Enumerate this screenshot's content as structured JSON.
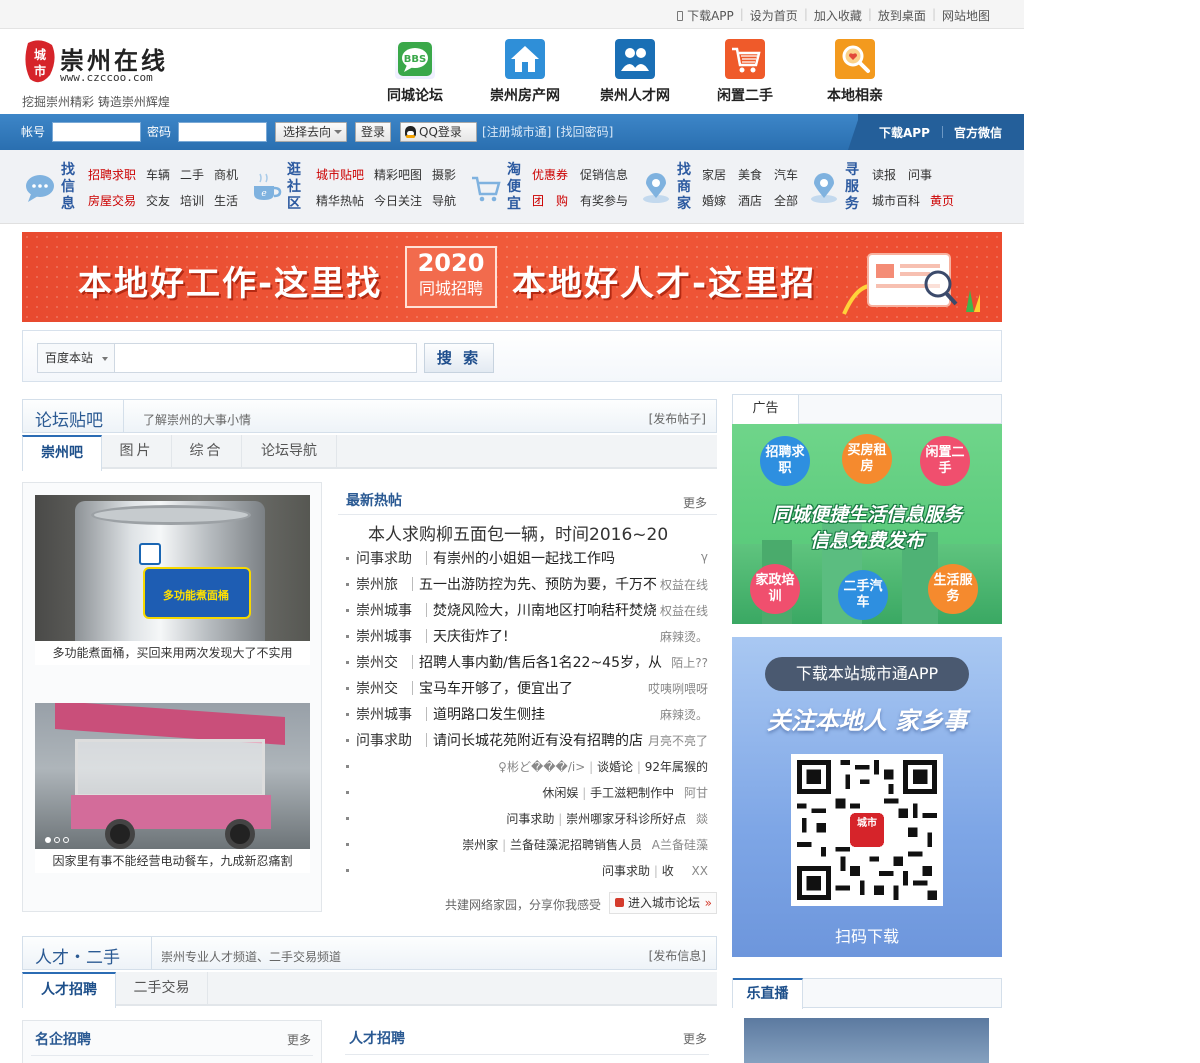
{
  "topbar": {
    "links": [
      "下载APP",
      "设为首页",
      "加入收藏",
      "放到桌面",
      "网站地图"
    ]
  },
  "header": {
    "logo_title": "崇州在线",
    "logo_url": "www.czccoo.com",
    "logo_mark_text": "城市",
    "slogan": "挖掘崇州精彩 铸造崇州辉煌",
    "nav": [
      {
        "label": "同城论坛",
        "icon": "bbs-icon",
        "color": "#3aa84a"
      },
      {
        "label": "崇州房产网",
        "icon": "house-icon",
        "color": "#2f8fd8"
      },
      {
        "label": "崇州人才网",
        "icon": "people-icon",
        "color": "#1a6fb5"
      },
      {
        "label": "闲置二手",
        "icon": "cart-icon",
        "color": "#ef5a2a"
      },
      {
        "label": "本地相亲",
        "icon": "search-heart-icon",
        "color": "#f39a1e"
      }
    ]
  },
  "login": {
    "account_label": "帐号",
    "password_label": "密码",
    "goto_select": "选择去向",
    "login_button": "登录",
    "qq_login": "QQ登录",
    "register": "[注册城市通]",
    "recover": "[找回密码]",
    "download_app": "下载APP",
    "official_wechat": "官方微信"
  },
  "categories": [
    {
      "title": "找信息",
      "icon": "chat-bubble-icon",
      "links": [
        {
          "t": "招聘求职",
          "red": true
        },
        {
          "t": "车辆"
        },
        {
          "t": "二手"
        },
        {
          "t": "商机"
        },
        {
          "t": "房屋交易",
          "red": true
        },
        {
          "t": "交友"
        },
        {
          "t": "培训"
        },
        {
          "t": "生活"
        }
      ]
    },
    {
      "title": "逛社区",
      "icon": "coffee-cup-icon",
      "links": [
        {
          "t": "城市贴吧",
          "red": true
        },
        {
          "t": "精彩吧图"
        },
        {
          "t": "摄影"
        },
        {
          "t": "精华热帖"
        },
        {
          "t": "今日关注"
        },
        {
          "t": "导航"
        }
      ]
    },
    {
      "title": "淘便宜",
      "icon": "shopping-cart-icon",
      "links": [
        {
          "t": "优惠券",
          "red": true
        },
        {
          "t": "促销信息"
        },
        {
          "t": "团　购",
          "red": true
        },
        {
          "t": "有奖参与"
        }
      ]
    },
    {
      "title": "找商家",
      "icon": "map-pin-icon",
      "links": [
        {
          "t": "家居"
        },
        {
          "t": "美食"
        },
        {
          "t": "汽车"
        },
        {
          "t": "婚嫁"
        },
        {
          "t": "酒店"
        },
        {
          "t": "全部"
        }
      ]
    },
    {
      "title": "寻服务",
      "icon": "service-pin-icon",
      "links": [
        {
          "t": "读报"
        },
        {
          "t": "问事"
        },
        {
          "t": "城市百科"
        },
        {
          "t": "黄页",
          "red": true
        }
      ]
    }
  ],
  "banner": {
    "left": "本地好工作-这里找",
    "year": "2020",
    "badge": "同城招聘",
    "right": "本地好人才-这里招"
  },
  "search": {
    "scope": "百度本站",
    "button": "搜 索"
  },
  "forum": {
    "title": "论坛贴吧",
    "subtitle": "了解崇州的大事小情",
    "action": "[发布帖子]",
    "tabs": [
      "崇州吧",
      "图片",
      "综合",
      "论坛导航"
    ],
    "photos": [
      {
        "caption": "多功能煮面桶，买回来用两次发现大了不实用",
        "sticker": "多功能煮面桶"
      },
      {
        "caption": "因家里有事不能经营电动餐车，九成新忍痛割"
      }
    ],
    "hot_title": "最新热帖",
    "hot_more": "更多",
    "head_post": "本人求购柳五面包一辆，时间2016~20",
    "posts": [
      {
        "cat": "问事求助",
        "title": "有崇州的小姐姐一起找工作吗",
        "author": "γ"
      },
      {
        "cat": "崇州旅",
        "title": "五一出游防控为先、预防为要，千万不",
        "author": "权益在线"
      },
      {
        "cat": "崇州城事",
        "title": "焚烧风险大，川南地区打响秸秆焚烧",
        "author": "权益在线"
      },
      {
        "cat": "崇州城事",
        "title": "天庆街炸了!",
        "author": "麻辣烫。"
      },
      {
        "cat": "崇州交",
        "title": "招聘人事内勤/售后各1名22~45岁，从",
        "author": "陌上??"
      },
      {
        "cat": "崇州交",
        "title": "宝马车开够了，便宜出了",
        "author": "哎咦咧喂呀"
      },
      {
        "cat": "崇州城事",
        "title": "道明路口发生侧挂",
        "author": "麻辣烫。"
      },
      {
        "cat": "问事求助",
        "title": "请问长城花苑附近有没有招聘的店",
        "author": "月亮不亮了"
      }
    ],
    "posts_right": [
      {
        "cat": "♀彬ど���/i>",
        "title": "谈婚论",
        "author": "92年属猴的"
      },
      {
        "cat": "休闲娱",
        "title": "手工滋粑制作中",
        "author": "阿甘"
      },
      {
        "cat": "问事求助",
        "title": "崇州哪家牙科诊所好点",
        "author": "燚"
      },
      {
        "cat": "崇州家",
        "title": "兰备硅藻泥招聘销售人员",
        "author": "A兰备硅藻"
      },
      {
        "cat": "问事求助",
        "title": "收",
        "author": "XX"
      }
    ],
    "footer_text": "共建网络家园，分享你我感受",
    "enter_forum": "进入城市论坛"
  },
  "ads": {
    "tab": "广告",
    "green": {
      "circles": [
        "招聘求职",
        "买房租房",
        "闲置二手",
        "家政培训",
        "二手汽车",
        "生活服务"
      ],
      "headline1": "同城便捷生活信息服务",
      "headline2": "信息免费发布"
    },
    "blue": {
      "pill": "下载本站城市通APP",
      "slogan": "关注本地人 家乡事",
      "qr_center": "城市",
      "scan": "扫码下载"
    }
  },
  "talent": {
    "title": "人才・二手",
    "subtitle": "崇州专业人才频道、二手交易频道",
    "action": "[发布信息]",
    "tabs": [
      "人才招聘",
      "二手交易"
    ],
    "box1_title": "名企招聘",
    "box1_more": "更多",
    "box2_title": "人才招聘",
    "box2_more": "更多"
  },
  "live": {
    "tab": "乐直播"
  }
}
